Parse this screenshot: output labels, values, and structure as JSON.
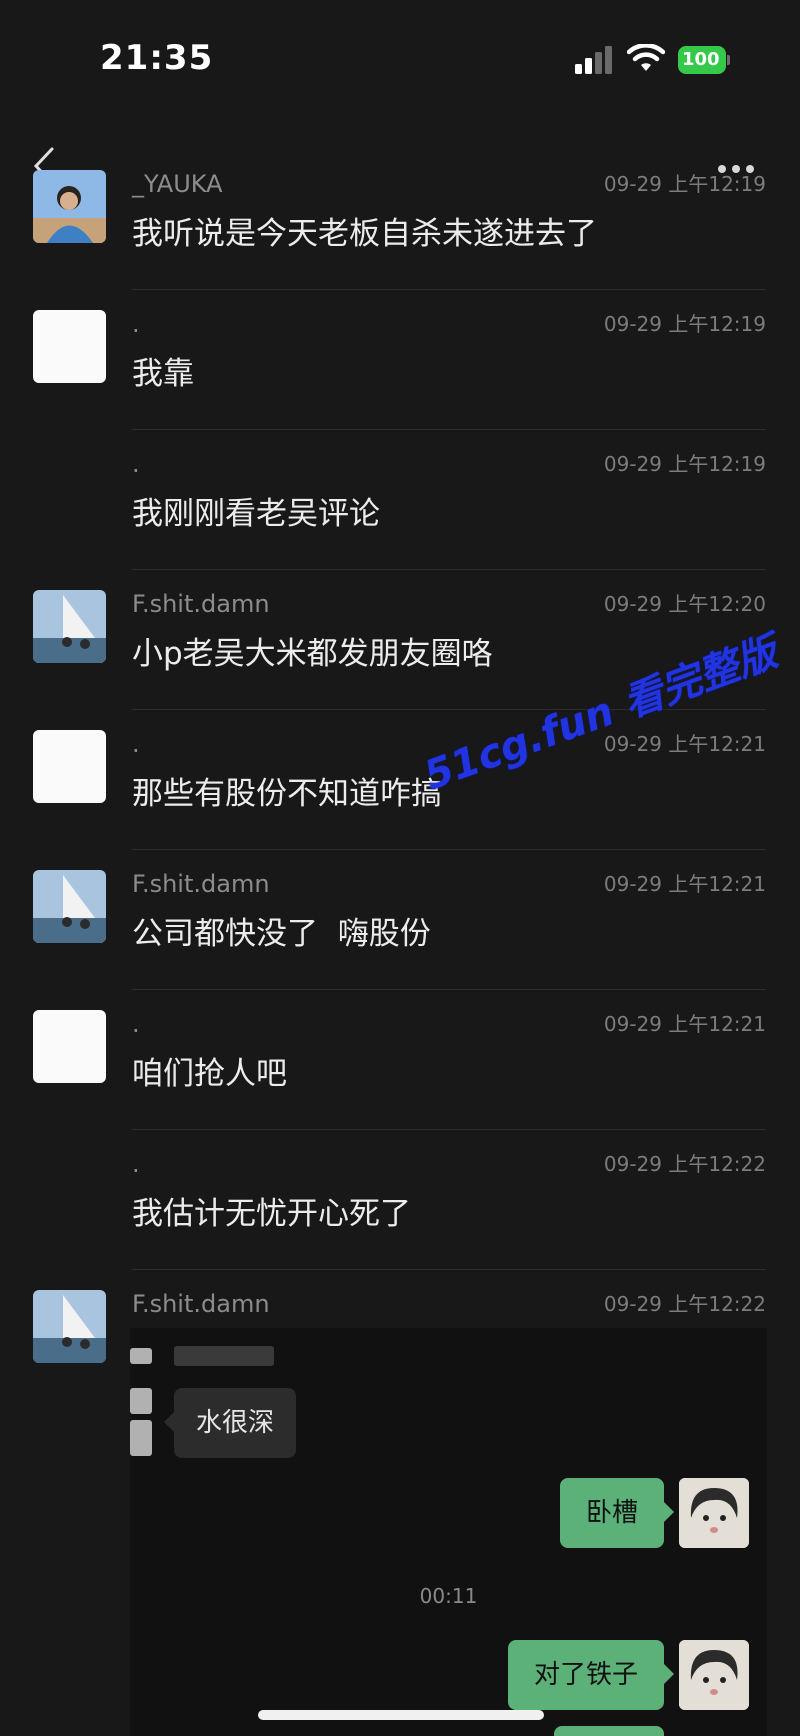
{
  "status_bar": {
    "time": "21:35",
    "battery": "100"
  },
  "messages": [
    {
      "sender": "_YAUKA",
      "time": "09-29 上午12:19",
      "text": "我听说是今天老板自杀未遂进去了",
      "avatar": "photo-person"
    },
    {
      "sender": ".",
      "time": "09-29 上午12:19",
      "text": "我靠",
      "avatar": "blank"
    },
    {
      "sender": ".",
      "time": "09-29 上午12:19",
      "text": "我刚刚看老吴评论",
      "avatar": "none"
    },
    {
      "sender": "F.shit.damn",
      "time": "09-29 上午12:20",
      "text": "小p老吴大米都发朋友圈咯",
      "avatar": "photo-sail"
    },
    {
      "sender": ".",
      "time": "09-29 上午12:21",
      "text": "那些有股份不知道咋搞",
      "avatar": "blank"
    },
    {
      "sender": "F.shit.damn",
      "time": "09-29 上午12:21",
      "text": "公司都快没了  嗨股份",
      "avatar": "photo-sail"
    },
    {
      "sender": ".",
      "time": "09-29 上午12:21",
      "text": "咱们抢人吧",
      "avatar": "blank"
    },
    {
      "sender": ".",
      "time": "09-29 上午12:22",
      "text": "我估计无忧开心死了",
      "avatar": "none"
    },
    {
      "sender": "F.shit.damn",
      "time": "09-29 上午12:22",
      "text": "",
      "avatar": "photo-sail"
    }
  ],
  "embedded_chat": {
    "left_bubble": "水很深",
    "right_bubble_1": "卧槽",
    "center_time": "00:11",
    "right_bubble_2": "对了铁子"
  },
  "watermark": "51cg.fun 看完整版",
  "colors": {
    "background": "#181818",
    "bubble_green": "#5cb178",
    "battery_green": "#35c94a",
    "watermark_blue": "#2134e0"
  }
}
